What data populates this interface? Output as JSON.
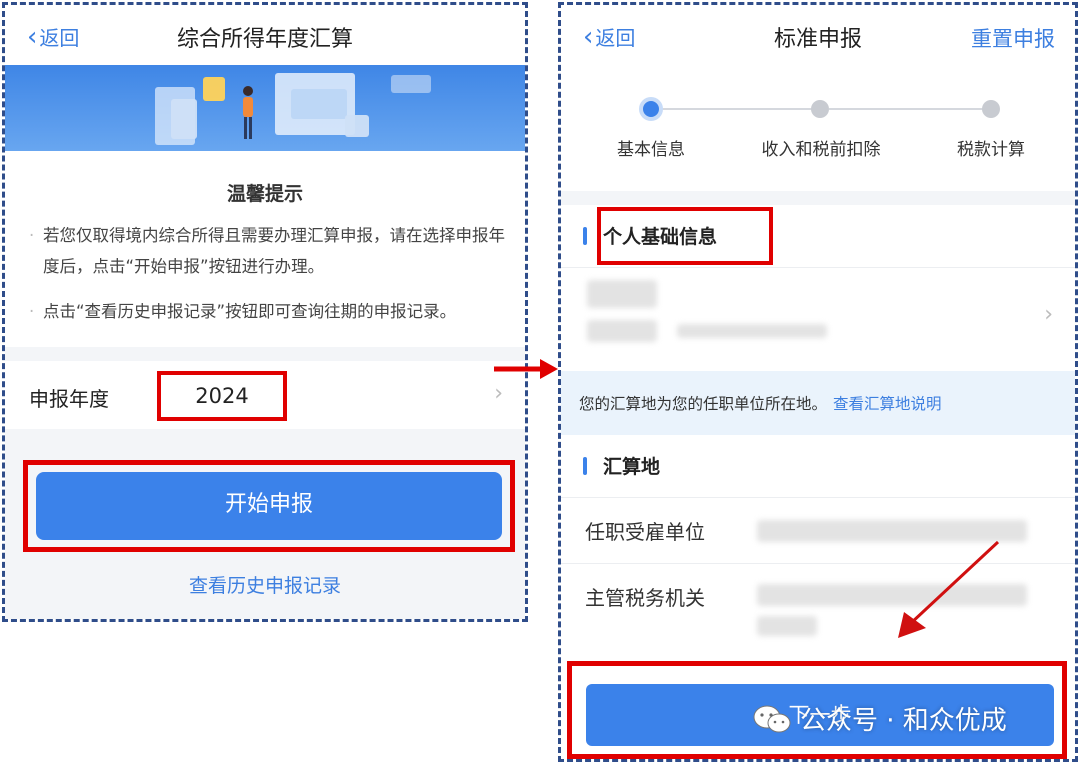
{
  "left": {
    "nav": {
      "back": "返回",
      "title": "综合所得年度汇算"
    },
    "tips": {
      "title": "温馨提示",
      "items": [
        "若您仅取得境内综合所得且需要办理汇算申报，请在选择申报年度后，点击“开始申报”按钮进行办理。",
        "点击“查看历史申报记录”按钮即可查询往期的申报记录。"
      ]
    },
    "year_row": {
      "label": "申报年度",
      "value": "2024",
      "arrow": "›"
    },
    "start_button": "开始申报",
    "history_link": "查看历史申报记录"
  },
  "right": {
    "nav": {
      "back": "返回",
      "title": "标准申报",
      "reset": "重置申报"
    },
    "steps": [
      {
        "label": "基本信息",
        "active": true
      },
      {
        "label": "收入和税前扣除",
        "active": false
      },
      {
        "label": "税款计算",
        "active": false
      }
    ],
    "basic_section": {
      "title": "个人基础信息",
      "arrow": "›"
    },
    "notice": {
      "text": "您的汇算地为您的任职单位所在地。",
      "link": "查看汇算地说明"
    },
    "settle_section": {
      "title": "汇算地"
    },
    "rows": [
      {
        "label": "任职受雇单位"
      },
      {
        "label": "主管税务机关"
      }
    ],
    "next_button": "下一步"
  },
  "watermark": "公众号 · 和众优成",
  "colors": {
    "accent": "#3b82ea",
    "highlight": "#e00000",
    "border": "#2f4d8a"
  }
}
